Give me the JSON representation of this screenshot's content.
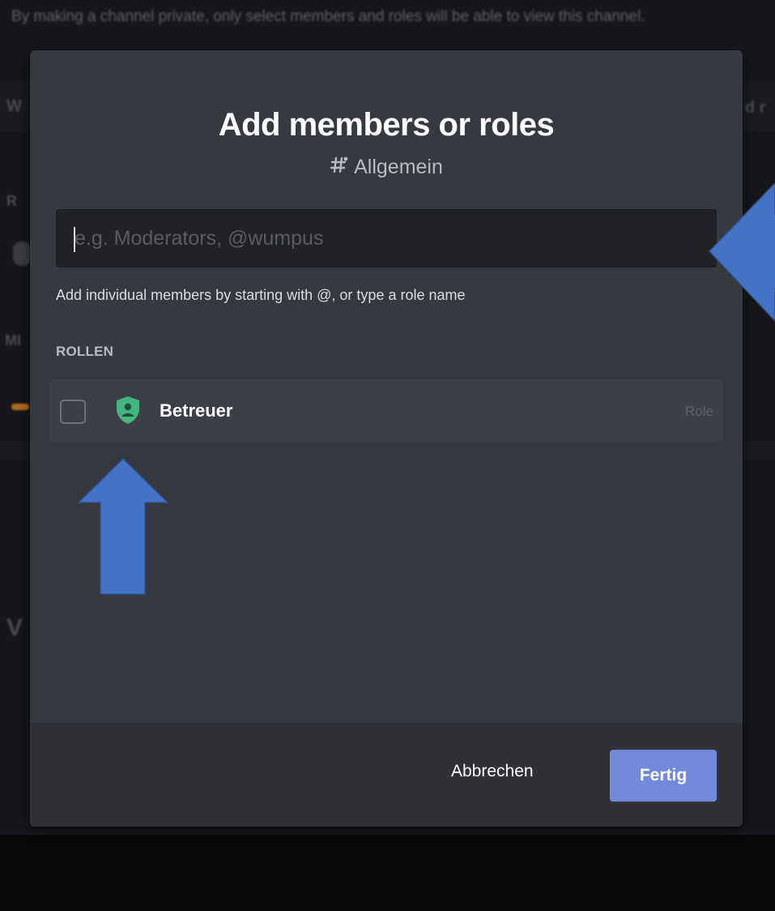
{
  "background": {
    "notice": "By making a channel private, only select members and roles will be able to view this channel.",
    "fragments": [
      "W",
      "R",
      "MI",
      "V",
      "d r"
    ]
  },
  "modal": {
    "title": "Add members or roles",
    "channel_icon": "hash-icon",
    "channel_name": "Allgemein",
    "search": {
      "value": "",
      "placeholder": "e.g. Moderators, @wumpus"
    },
    "hint": "Add individual members by starting with @, or type a role name",
    "section_label": "ROLLEN",
    "roles": [
      {
        "name": "Betreuer",
        "type_label": "Role",
        "icon": "role-shield-icon",
        "color": "#43b581",
        "checked": false
      }
    ],
    "footer": {
      "cancel_label": "Abbrechen",
      "confirm_label": "Fertig"
    }
  },
  "colors": {
    "modal_bg": "#36393f",
    "footer_bg": "#2f3136",
    "input_bg": "#202225",
    "accent": "#7289da",
    "role_green": "#43b581",
    "annotation_arrow": "#4472c4"
  }
}
